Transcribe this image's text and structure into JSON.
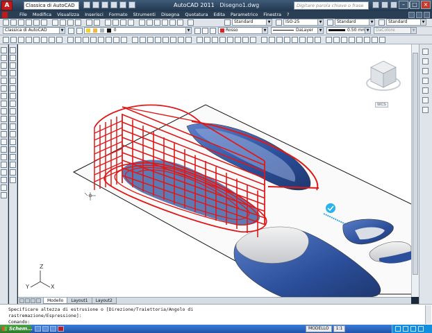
{
  "window": {
    "title_app": "AutoCAD 2011",
    "title_file": "Disegno1.dwg",
    "workspace_selector": "Classica di AutoCAD",
    "help_search_placeholder": "Digitare parola chiave o frase"
  },
  "menubar": {
    "items": [
      "File",
      "Modifica",
      "Visualizza",
      "Inserisci",
      "Formato",
      "Strumenti",
      "Disegna",
      "Quotatura",
      "Edita",
      "Parametrico",
      "Finestra",
      "?"
    ]
  },
  "toolbar": {
    "text_style": "Standard",
    "dim_style": "ISO-25",
    "table_style": "Standard",
    "multileader_style": "Standard",
    "workspace": "Classica di AutoCAD",
    "layer": "0",
    "color": "Rosso",
    "color_hex": "#e02020",
    "linetype": "DaLayer",
    "lineweight": "0.50 mm",
    "plotstyle": "DaColore"
  },
  "viewcube": {
    "wcs_label": "WCS"
  },
  "ucs": {
    "x_label": "X",
    "y_label": "Y",
    "z_label": "Z"
  },
  "tabs": {
    "items": [
      "Modello",
      "Layout1",
      "Layout2"
    ]
  },
  "command_line": {
    "line1": "Specificare altezza di estrusione o [Direzione/Traiettoria/Angolo di",
    "line2": "rastremazione/Espressione]:",
    "line3": "Comando:"
  },
  "taskbar": {
    "start_label": "Schem...",
    "status_model": "MODELLO",
    "status_scale": "1:1"
  },
  "colors": {
    "wire_red": "#e01818",
    "shell_blue": "#2a4f9a"
  }
}
